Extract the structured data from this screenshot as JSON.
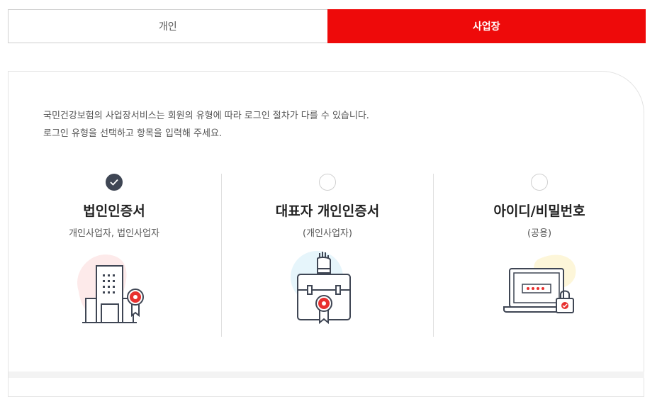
{
  "tabs": [
    {
      "label": "개인",
      "active": false
    },
    {
      "label": "사업장",
      "active": true
    }
  ],
  "intro": {
    "line1": "국민건강보험의 사업장서비스는 회원의 유형에 따라 로그인 절차가 다를 수 있습니다.",
    "line2": "로그인 유형을 선택하고 항목을 입력해 주세요."
  },
  "options": [
    {
      "title": "법인인증서",
      "subtitle": "개인사업자, 법인사업자",
      "selected": true,
      "icon": "building-certificate-icon"
    },
    {
      "title": "대표자 개인인증서",
      "subtitle": "(개인사업자)",
      "selected": false,
      "icon": "briefcase-certificate-icon"
    },
    {
      "title": "아이디/비밀번호",
      "subtitle": "(공용)",
      "selected": false,
      "icon": "laptop-lock-icon"
    }
  ],
  "colors": {
    "accent": "#ee0a0a",
    "selected_radio": "#3f4654"
  }
}
